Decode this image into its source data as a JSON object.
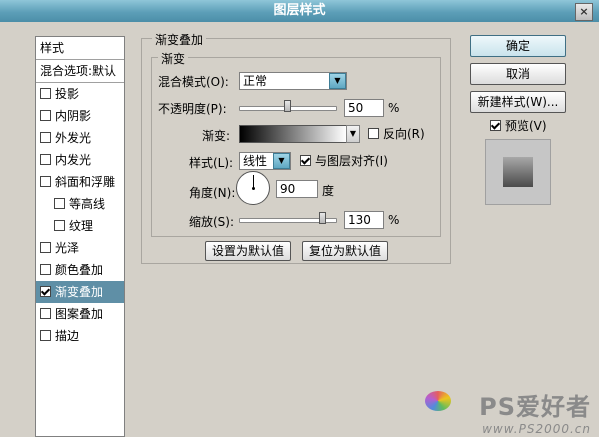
{
  "window": {
    "title": "图层样式",
    "close_label": "×"
  },
  "style_list": {
    "header": "样式",
    "blend_options": "混合选项:默认",
    "items": [
      {
        "label": "投影",
        "checked": false,
        "sub": false,
        "selected": false
      },
      {
        "label": "内阴影",
        "checked": false,
        "sub": false,
        "selected": false
      },
      {
        "label": "外发光",
        "checked": false,
        "sub": false,
        "selected": false
      },
      {
        "label": "内发光",
        "checked": false,
        "sub": false,
        "selected": false
      },
      {
        "label": "斜面和浮雕",
        "checked": false,
        "sub": false,
        "selected": false
      },
      {
        "label": "等高线",
        "checked": false,
        "sub": true,
        "selected": false
      },
      {
        "label": "纹理",
        "checked": false,
        "sub": true,
        "selected": false
      },
      {
        "label": "光泽",
        "checked": false,
        "sub": false,
        "selected": false
      },
      {
        "label": "颜色叠加",
        "checked": false,
        "sub": false,
        "selected": false
      },
      {
        "label": "渐变叠加",
        "checked": true,
        "sub": false,
        "selected": true
      },
      {
        "label": "图案叠加",
        "checked": false,
        "sub": false,
        "selected": false
      },
      {
        "label": "描边",
        "checked": false,
        "sub": false,
        "selected": false
      }
    ]
  },
  "gradient_overlay": {
    "group_title": "渐变叠加",
    "inner_title": "渐变",
    "blend_mode_label": "混合模式(O):",
    "blend_mode_value": "正常",
    "opacity_label": "不透明度(P):",
    "opacity_value": "50",
    "opacity_unit": "%",
    "opacity_fraction": 0.5,
    "gradient_label": "渐变:",
    "reverse_label": "反向(R)",
    "reverse_checked": false,
    "style_label": "样式(L):",
    "style_value": "线性",
    "align_label": "与图层对齐(I)",
    "align_checked": true,
    "angle_label": "角度(N):",
    "angle_value": "90",
    "angle_unit": "度",
    "scale_label": "缩放(S):",
    "scale_value": "130",
    "scale_unit": "%",
    "scale_fraction": 0.86,
    "make_default_button": "设置为默认值",
    "reset_default_button": "复位为默认值"
  },
  "buttons": {
    "ok": "确定",
    "cancel": "取消",
    "new_style": "新建样式(W)...",
    "preview_label": "预览(V)",
    "preview_checked": true
  },
  "watermark": {
    "logo": "PS爱好者",
    "url": "www.PS2000.cn"
  }
}
